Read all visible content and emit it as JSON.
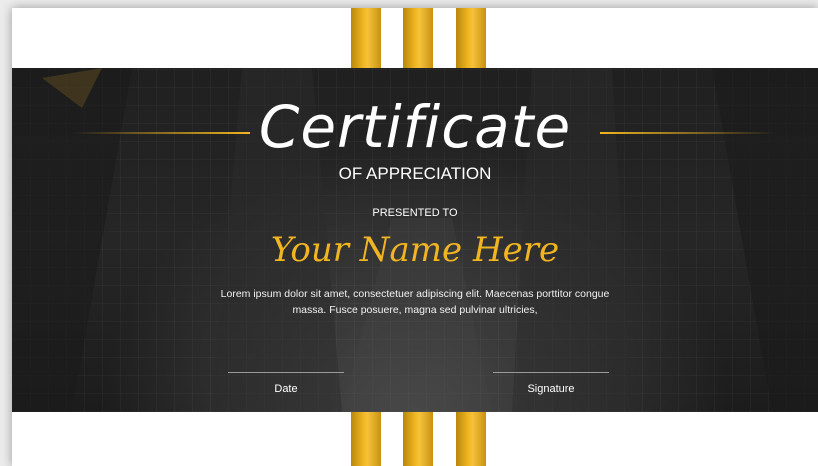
{
  "certificate": {
    "title": "Certificate",
    "subtitle": "OF APPRECIATION",
    "presented_to": "PRESENTED TO",
    "recipient_name": "Your Name Here",
    "body_line1": "Lorem ipsum dolor sit amet, consectetuer adipiscing elit. Maecenas porttitor congue",
    "body_line2": "massa. Fusce posuere, magna sed pulvinar ultricies,",
    "date_label": "Date",
    "signature_label": "Signature"
  },
  "colors": {
    "accent_gold": "#f0b520",
    "band_dark": "#222222",
    "text_white": "#ffffff"
  }
}
